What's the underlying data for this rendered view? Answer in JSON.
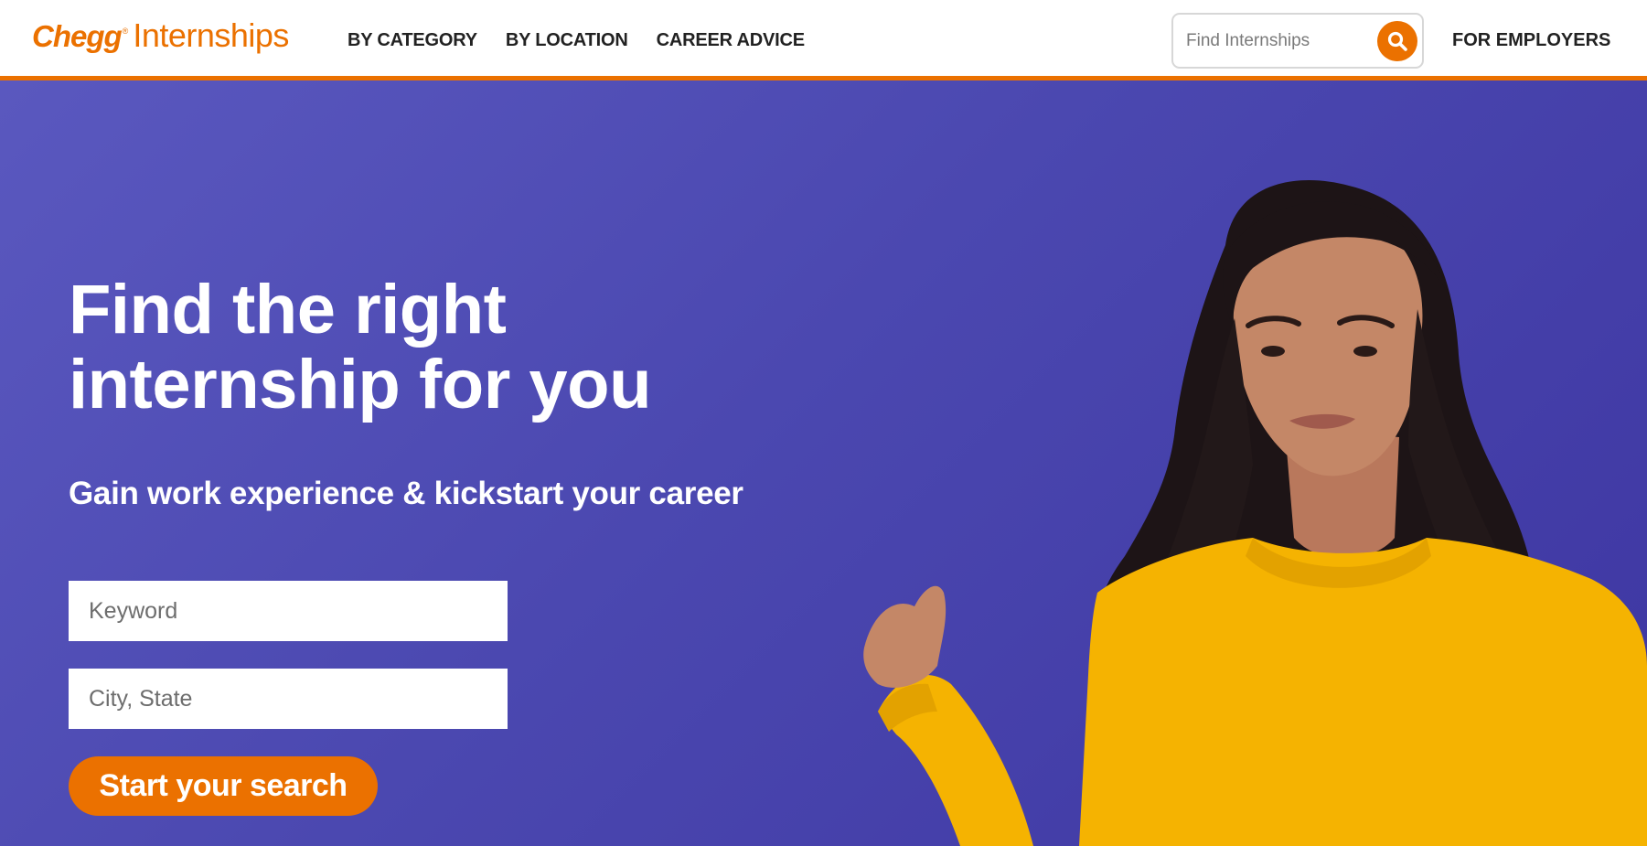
{
  "header": {
    "logo_brand": "Chegg",
    "logo_reg": "®",
    "logo_product": "Internships",
    "nav": [
      {
        "label": "BY CATEGORY"
      },
      {
        "label": "BY LOCATION"
      },
      {
        "label": "CAREER ADVICE"
      }
    ],
    "search_placeholder": "Find Internships",
    "employers_label": "FOR EMPLOYERS"
  },
  "hero": {
    "headline_line1": "Find the right",
    "headline_line2": "internship for you",
    "subheadline": "Gain work experience & kickstart your career",
    "keyword_placeholder": "Keyword",
    "location_placeholder": "City, State",
    "cta_label": "Start your search"
  },
  "colors": {
    "brand_orange": "#eb7100",
    "hero_purple": "#4b48b0",
    "sweater_yellow": "#f5b301"
  }
}
